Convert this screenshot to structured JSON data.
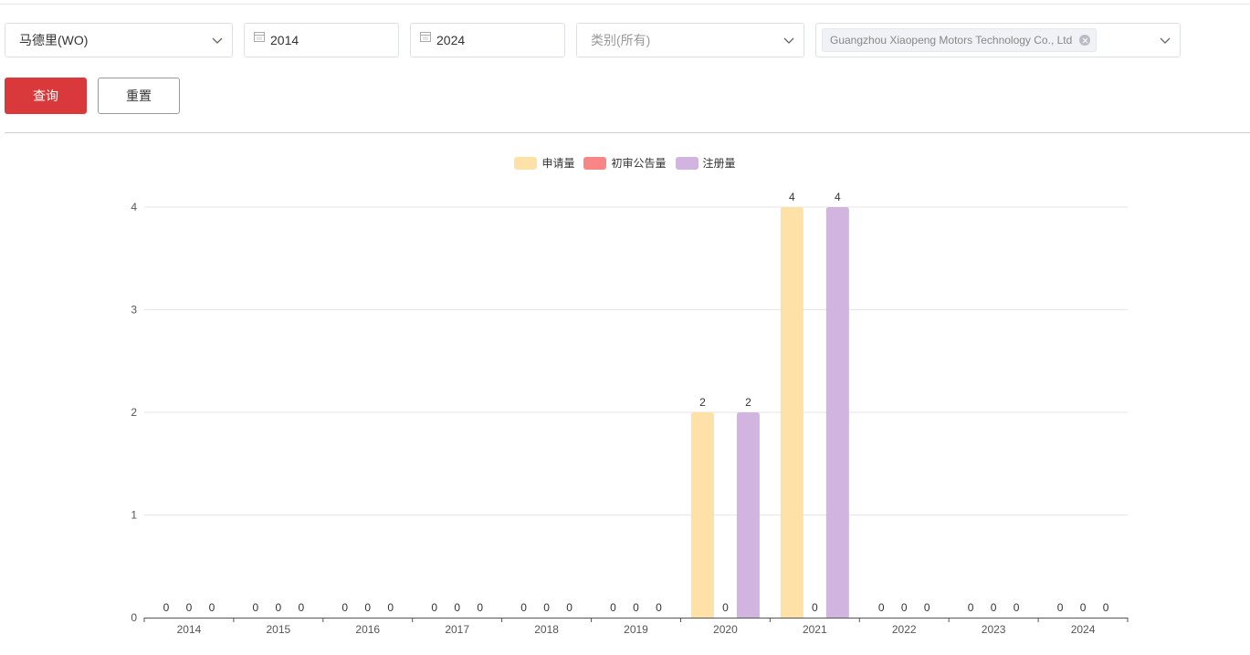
{
  "filters": {
    "trademark": {
      "value": "马德里(WO)"
    },
    "start_year": {
      "value": "2014"
    },
    "end_year": {
      "value": "2024"
    },
    "category": {
      "placeholder": "类别(所有)"
    },
    "applicant": {
      "tag": "Guangzhou Xiaopeng Motors Technology Co., Ltd"
    }
  },
  "actions": {
    "query_label": "查询",
    "reset_label": "重置"
  },
  "colors": {
    "primary": "#d9393b",
    "application": "#fde1a6",
    "preliminary": "#f98686",
    "registration": "#d2b4e0"
  },
  "chart_data": {
    "type": "bar",
    "categories": [
      "2014",
      "2015",
      "2016",
      "2017",
      "2018",
      "2019",
      "2020",
      "2021",
      "2022",
      "2023",
      "2024"
    ],
    "series": [
      {
        "name": "申请量",
        "color": "#fde1a6",
        "values": [
          0,
          0,
          0,
          0,
          0,
          0,
          2,
          4,
          0,
          0,
          0
        ]
      },
      {
        "name": "初审公告量",
        "color": "#f98686",
        "values": [
          0,
          0,
          0,
          0,
          0,
          0,
          0,
          0,
          0,
          0,
          0
        ]
      },
      {
        "name": "注册量",
        "color": "#d2b4e0",
        "values": [
          0,
          0,
          0,
          0,
          0,
          0,
          2,
          4,
          0,
          0,
          0
        ]
      }
    ],
    "ylim": [
      0,
      4
    ],
    "yticks": [
      0,
      1,
      2,
      3,
      4
    ],
    "grid": true,
    "legend_position": "top-center",
    "data_labels": true
  }
}
